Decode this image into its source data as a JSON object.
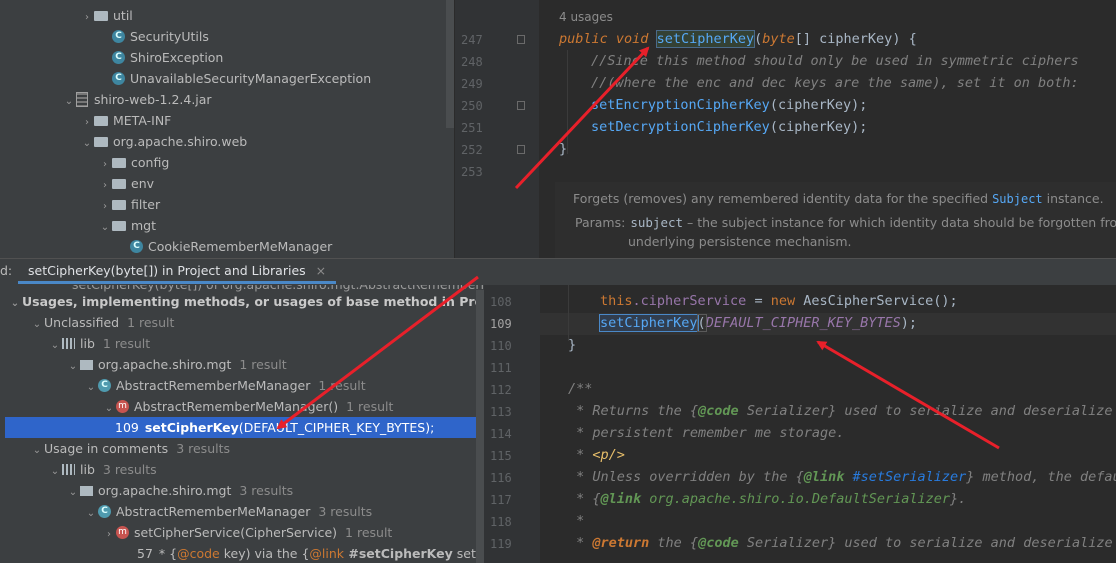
{
  "project_tree": {
    "items": [
      {
        "label": "util",
        "type": "folder",
        "indent": 1,
        "chevron": "›"
      },
      {
        "label": "SecurityUtils",
        "type": "class",
        "indent": 2
      },
      {
        "label": "ShiroException",
        "type": "class",
        "indent": 2
      },
      {
        "label": "UnavailableSecurityManagerException",
        "type": "class",
        "indent": 2
      },
      {
        "label": "shiro-web-1.2.4.jar",
        "type": "jar",
        "indent": 0,
        "chevron": "⌄"
      },
      {
        "label": "META-INF",
        "type": "folder",
        "indent": 1,
        "chevron": "›"
      },
      {
        "label": "org.apache.shiro.web",
        "type": "folder",
        "indent": 1,
        "chevron": "⌄"
      },
      {
        "label": "config",
        "type": "folder",
        "indent": 2,
        "chevron": "›"
      },
      {
        "label": "env",
        "type": "folder",
        "indent": 2,
        "chevron": "›"
      },
      {
        "label": "filter",
        "type": "folder",
        "indent": 2,
        "chevron": "›"
      },
      {
        "label": "mgt",
        "type": "folder",
        "indent": 2,
        "chevron": "⌄"
      },
      {
        "label": "CookieRememberMeManager",
        "type": "class",
        "indent": 3
      }
    ]
  },
  "editor_top": {
    "usages": "4 usages",
    "lines": [
      "247",
      "248",
      "249",
      "250",
      "251",
      "252",
      "253"
    ],
    "code": {
      "l247_kw1": "public",
      "l247_kw2": "void",
      "l247_name": "setCipherKey",
      "l247_rest1": "(",
      "l247_kw3": "byte",
      "l247_rest2": "[] cipherKey) {",
      "l248": "//Since this method should only be used in symmetric ciphers",
      "l249": "//(where the enc and dec keys are the same), set it on both:",
      "l250_call": "setEncryptionCipherKey",
      "l250_rest": "(cipherKey);",
      "l251_call": "setDecryptionCipherKey",
      "l251_rest": "(cipherKey);",
      "l252": "}"
    },
    "doc": {
      "text1": "Forgets (removes) any remembered identity data for the specified ",
      "code1": "Subject",
      "text2": " instance.",
      "params_label": "Params:",
      "param_name": "subject",
      "param_desc": " – the subject instance for which identity data should be forgotten from",
      "param_desc2": "underlying persistence mechanism."
    }
  },
  "find_tab": {
    "prefix": "d:",
    "label": "setCipherKey(byte[]) in Project and Libraries",
    "close": "×"
  },
  "results": {
    "cut_top": "setCipherKey(byte[]) of org.apache.shiro.mgt.AbstractRememberMe...",
    "root": "Usages, implementing methods, or usages of base method in Project and",
    "rows": [
      {
        "label": "Unclassified",
        "count": "1 result",
        "indent": 1,
        "icon": "none",
        "chevron": "⌄"
      },
      {
        "label": "lib",
        "count": "1 result",
        "indent": 2,
        "icon": "lib",
        "chevron": "⌄"
      },
      {
        "label": "org.apache.shiro.mgt",
        "count": "1 result",
        "indent": 3,
        "icon": "pkg",
        "chevron": "⌄"
      },
      {
        "label": "AbstractRememberMeManager",
        "count": "1 result",
        "indent": 4,
        "icon": "class",
        "chevron": "⌄"
      },
      {
        "label": "AbstractRememberMeManager()",
        "count": "1 result",
        "indent": 5,
        "icon": "method",
        "chevron": "⌄"
      },
      {
        "label": "DEFAULT_CIPHER_KEY_BYTES);",
        "count": "",
        "indent": 6,
        "icon": "none",
        "chevron": "",
        "line_no": "109",
        "bold": "setCipherKey",
        "paren": "(",
        "selected": true
      },
      {
        "label": "Usage in comments",
        "count": "3 results",
        "indent": 1,
        "icon": "none",
        "chevron": "⌄"
      },
      {
        "label": "lib",
        "count": "3 results",
        "indent": 2,
        "icon": "lib",
        "chevron": "⌄"
      },
      {
        "label": "org.apache.shiro.mgt",
        "count": "3 results",
        "indent": 3,
        "icon": "pkg",
        "chevron": "⌄"
      },
      {
        "label": "AbstractRememberMeManager",
        "count": "3 results",
        "indent": 4,
        "icon": "class",
        "chevron": "⌄"
      },
      {
        "label": "setCipherService(CipherService)",
        "count": "1 result",
        "indent": 5,
        "icon": "method",
        "chevron": "›"
      }
    ],
    "last_row": {
      "line_no": "57",
      "pre": "* {",
      "code": "@code",
      "mid": " key) via the {",
      "link": "@link",
      "bold": " #setCipherKey",
      "post": " setCipherKe"
    }
  },
  "preview": {
    "lines": [
      "108",
      "109",
      "110",
      "111",
      "112",
      "113",
      "114",
      "115",
      "116",
      "117",
      "118",
      "119"
    ],
    "l108_this": "this",
    "l108_field": ".cipherService",
    "l108_eq": " = ",
    "l108_new": "new",
    "l108_rest": " AesCipherService();",
    "l109_call": "setCipherKey",
    "l109_paren": "(",
    "l109_const": "DEFAULT_CIPHER_KEY_BYTES",
    "l109_end": ");",
    "l110": "}",
    "l112": "/**",
    "l113_a": " * Returns the {",
    "l113_tag": "@code",
    "l113_b": " Serializer} used to serialize and deserialize {",
    "l114": " * persistent remember me storage.",
    "l115_a": " * ",
    "l115_tag": "<p/>",
    "l116_a": " * Unless overridden by the {",
    "l116_tag": "@link",
    "l116_ref": " #setSerializer",
    "l116_b": "} method, the defaul",
    "l117_a": " * {",
    "l117_tag": "@link",
    "l117_ref": " org.apache.shiro.io.DefaultSerializer",
    "l117_b": "}.",
    "l118": " *",
    "l119_a": " * ",
    "l119_tag": "@return",
    "l119_b": " the {",
    "l119_tag2": "@code",
    "l119_c": " Serializer} used to serialize and deserialize {"
  },
  "colors": {
    "annotation_arrow": "#e8202a",
    "selection": "#2f65ca",
    "keyword": "#cc7832",
    "method": "#56a8f5",
    "comment": "#808080",
    "javadoc": "#629755",
    "field": "#9876aa"
  }
}
